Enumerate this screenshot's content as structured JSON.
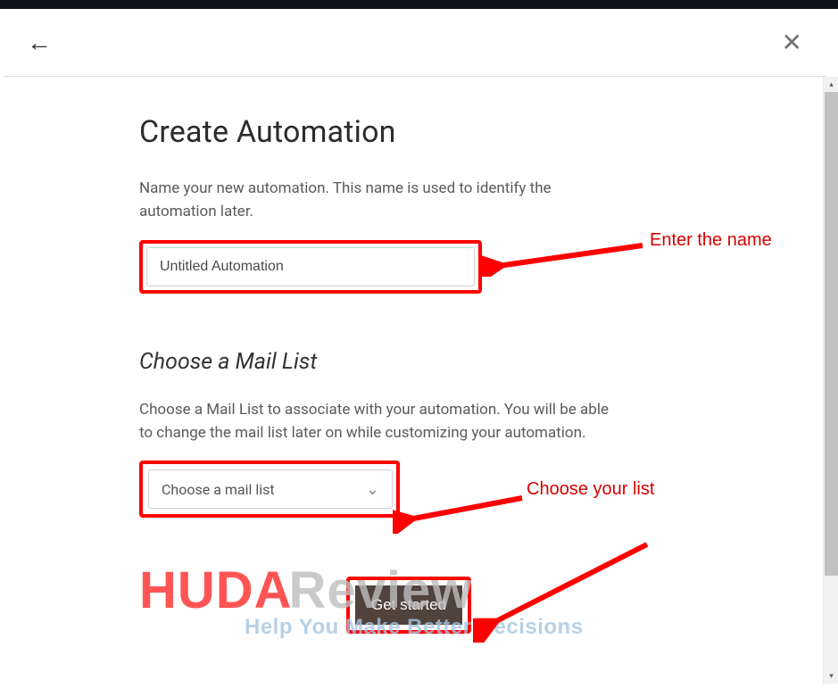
{
  "page": {
    "title": "Create Automation",
    "name_desc": "Name your new automation. This name is used to identify the automation later.",
    "name_value": "Untitled Automation",
    "list_title": "Choose a Mail List",
    "list_desc": "Choose a Mail List to associate with your automation. You will be able to change the mail list later on while customizing your automation.",
    "list_placeholder": "Choose a mail list",
    "cta": "Get started"
  },
  "icons": {
    "back": "←",
    "close": "✕",
    "chevron_down": "⌄",
    "scroll_up": "▴",
    "scroll_down": "▾"
  },
  "annotations": {
    "name": "Enter the name",
    "list": "Choose your list"
  },
  "watermark": {
    "brand_left": "HUDA",
    "brand_right": "Review",
    "tagline": "Help You Make Better Decisions"
  },
  "colors": {
    "highlight": "#ff0000",
    "annotation_text": "#d80000",
    "cta_bg": "#50423c"
  }
}
